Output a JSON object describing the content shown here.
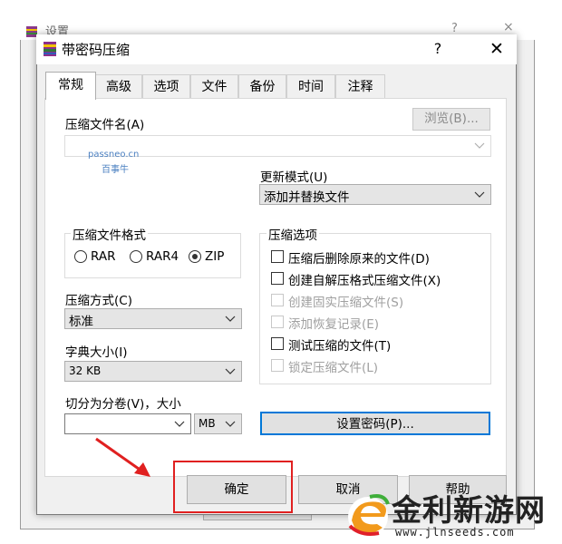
{
  "background_window": {
    "title": "设置",
    "help": "?",
    "close": "×"
  },
  "dialog": {
    "title": "带密码压缩",
    "help": "?",
    "close": "✕"
  },
  "tabs": [
    {
      "label": "常规",
      "active": true
    },
    {
      "label": "高级",
      "active": false
    },
    {
      "label": "选项",
      "active": false
    },
    {
      "label": "文件",
      "active": false
    },
    {
      "label": "备份",
      "active": false
    },
    {
      "label": "时间",
      "active": false
    },
    {
      "label": "注释",
      "active": false
    }
  ],
  "archive_name": {
    "label": "压缩文件名(A)",
    "value": "",
    "browse_button": "浏览(B)..."
  },
  "update_mode": {
    "label": "更新模式(U)",
    "value": "添加并替换文件"
  },
  "archive_format": {
    "title": "压缩文件格式",
    "options": [
      {
        "label": "RAR",
        "checked": false
      },
      {
        "label": "RAR4",
        "checked": false
      },
      {
        "label": "ZIP",
        "checked": true
      }
    ]
  },
  "compression_options": {
    "title": "压缩选项",
    "items": [
      {
        "label": "压缩后删除原来的文件(D)",
        "checked": false,
        "enabled": true
      },
      {
        "label": "创建自解压格式压缩文件(X)",
        "checked": false,
        "enabled": true
      },
      {
        "label": "创建固实压缩文件(S)",
        "checked": false,
        "enabled": false
      },
      {
        "label": "添加恢复记录(E)",
        "checked": false,
        "enabled": false
      },
      {
        "label": "测试压缩的文件(T)",
        "checked": false,
        "enabled": true
      },
      {
        "label": "锁定压缩文件(L)",
        "checked": false,
        "enabled": false
      }
    ]
  },
  "compression_method": {
    "label": "压缩方式(C)",
    "value": "标准"
  },
  "dictionary_size": {
    "label": "字典大小(I)",
    "value": "32 KB"
  },
  "split_volumes": {
    "label": "切分为分卷(V)，大小",
    "size_value": "",
    "unit": "MB"
  },
  "set_password_button": "设置密码(P)...",
  "footer": {
    "ok": "确定",
    "cancel": "取消",
    "help": "帮助"
  },
  "watermarks": {
    "passneo": "passneo.cn",
    "baishiniu": "百事牛",
    "brand": "金利新游网",
    "brand_url": "www.jlnseeds.com"
  },
  "colors": {
    "highlight_frame": "#e02020",
    "arrow": "#e02020",
    "watermark_blue": "#4a7fc0"
  }
}
